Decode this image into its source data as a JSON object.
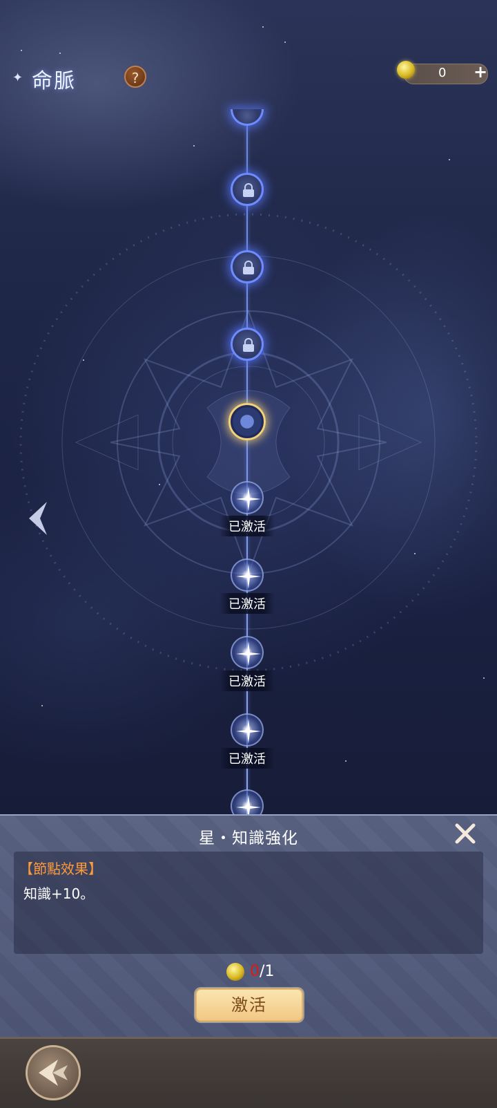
{
  "header": {
    "title": "命脈",
    "help_label": "?",
    "currency_amount": "0",
    "currency_add": "+"
  },
  "nodes": {
    "active_label": "已激活"
  },
  "detail": {
    "title": "星・知識強化",
    "effect_heading": "【節點效果】",
    "effect_text": "知識+10。",
    "cost_have": "0",
    "cost_need": "/1",
    "activate_label": "激活"
  },
  "colors": {
    "accent_gold": "#f1d27a",
    "node_blue": "#6f8cff",
    "insufficient_red": "#e01818"
  }
}
